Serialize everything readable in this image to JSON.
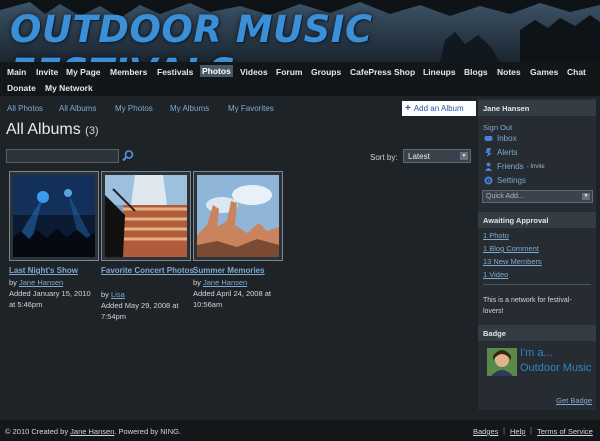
{
  "site": {
    "title": "OUTDOOR MUSIC FESTIVALS"
  },
  "nav": {
    "items": [
      "Main",
      "Invite",
      "My Page",
      "Members",
      "Festivals",
      "Photos",
      "Videos",
      "Forum",
      "Groups",
      "CafePress Shop",
      "Lineups",
      "Blogs",
      "Notes",
      "Games",
      "Chat",
      "Donate",
      "My Network"
    ],
    "active": "Photos"
  },
  "subnav": {
    "links": [
      "All Photos",
      "All Albums",
      "My Photos",
      "My Albums",
      "My Favorites"
    ],
    "add_album": "Add an Album"
  },
  "page": {
    "title": "All Albums",
    "count": "(3)"
  },
  "search": {
    "value": "",
    "placeholder": "",
    "icon": "search-icon"
  },
  "sort": {
    "label": "Sort by:",
    "selected": "Latest"
  },
  "albums": [
    {
      "name": "Last Night's Show",
      "by_label": "by",
      "author": "Jane Hansen",
      "added": "Added January 15, 2010",
      "time": "at 5:46pm"
    },
    {
      "name": "Favorite Concert Photos",
      "by_label": "by",
      "author": "Lisa",
      "added": "Added May 29, 2008 at",
      "time": "7:54pm"
    },
    {
      "name": "Summer Memories",
      "by_label": "by",
      "author": "Jane Hansen",
      "added": "Added April 24, 2008 at",
      "time": "10:56am"
    }
  ],
  "sidebar": {
    "user_name": "Jane Hansen",
    "sign_out": "Sign Out",
    "inbox": "Inbox",
    "alerts": "Alerts",
    "friends": "Friends",
    "invite": "- Invite",
    "settings": "Settings",
    "quick_add": "Quick Add...",
    "awaiting_title": "Awaiting Approval",
    "awaiting": [
      "1 Photo",
      "1 Blog Comment",
      "13 New Members",
      "1 Video"
    ],
    "note": "This is a network for festival-lovers!",
    "badge_title": "Badge",
    "badge_text": "I'm a... Outdoor Music",
    "get_badge": "Get Badge"
  },
  "footer": {
    "copyright": "© 2010   Created by",
    "creator": "Jane Hansen",
    "powered_by": ".   Powered by",
    "ning": "NING.",
    "links": [
      "Badges",
      "Help",
      "Terms of Service"
    ]
  },
  "colors": {
    "accent": "#7fa9d1",
    "title_blue": "#3a8fd6",
    "background": "#1e2327"
  }
}
